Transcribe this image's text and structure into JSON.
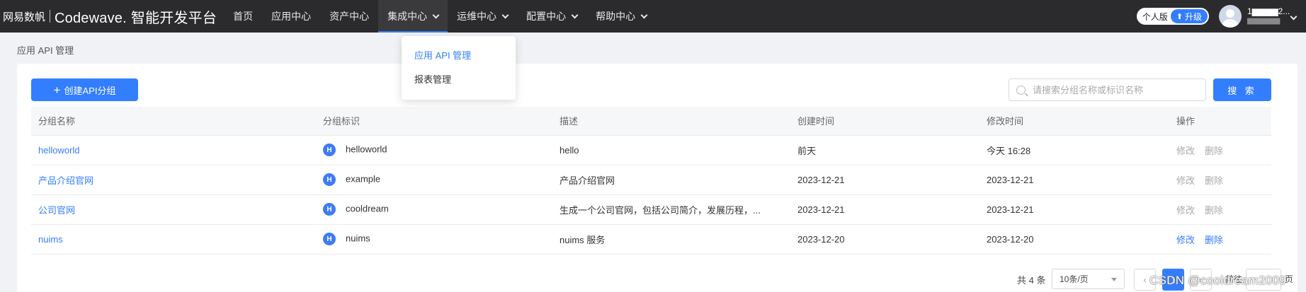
{
  "brand": {
    "company": "网易数帆",
    "product": "Codewave.",
    "platform": "智能开发平台"
  },
  "nav": [
    {
      "label": "首页",
      "has_menu": false
    },
    {
      "label": "应用中心",
      "has_menu": false
    },
    {
      "label": "资产中心",
      "has_menu": false
    },
    {
      "label": "集成中心",
      "has_menu": true,
      "active": true
    },
    {
      "label": "运维中心",
      "has_menu": true
    },
    {
      "label": "配置中心",
      "has_menu": true
    },
    {
      "label": "帮助中心",
      "has_menu": true
    }
  ],
  "user": {
    "edition": "个人版",
    "upgrade": "升级",
    "name": "1▆▆▆▆2...",
    "sub": "▆▆▆▆▆▆"
  },
  "dropdown": [
    "应用 API 管理",
    "报表管理"
  ],
  "breadcrumb": "应用 API 管理",
  "toolbar": {
    "create_label": "创建API分组",
    "search_placeholder": "请搜索分组名称或标识名称",
    "search_label": "搜 索"
  },
  "table": {
    "headers": [
      "分组名称",
      "分组标识",
      "描述",
      "创建时间",
      "修改时间",
      "操作"
    ],
    "rows": [
      {
        "name": "helloworld",
        "badge": "H",
        "ident": "helloworld",
        "desc": "hello",
        "created": "前天",
        "modified": "今天 16:28",
        "edit": "修改",
        "del": "删除",
        "enabled": false
      },
      {
        "name": "产品介绍官网",
        "badge": "H",
        "ident": "example",
        "desc": "产品介绍官网",
        "created": "2023-12-21",
        "modified": "2023-12-21",
        "edit": "修改",
        "del": "删除",
        "enabled": false
      },
      {
        "name": "公司官网",
        "badge": "H",
        "ident": "cooldream",
        "desc": "生成一个公司官网，包括公司简介，发展历程，...",
        "created": "2023-12-21",
        "modified": "2023-12-21",
        "edit": "修改",
        "del": "删除",
        "enabled": false
      },
      {
        "name": "nuims",
        "badge": "H",
        "ident": "nuims",
        "desc": "nuims 服务",
        "created": "2023-12-20",
        "modified": "2023-12-20",
        "edit": "修改",
        "del": "删除",
        "enabled": true
      }
    ]
  },
  "pagination": {
    "total": "共 4 条",
    "page_size": "10条/页",
    "current": "1",
    "goto": "前往",
    "goto_end": "页"
  },
  "watermark": "CSDN @cooldream2009",
  "colors": {
    "accent": "#337eff",
    "topbar": "#2b2b2d"
  }
}
